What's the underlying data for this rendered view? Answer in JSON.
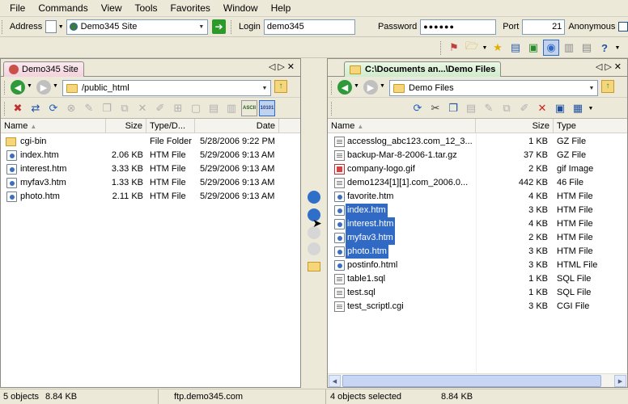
{
  "menu": [
    "File",
    "Commands",
    "View",
    "Tools",
    "Favorites",
    "Window",
    "Help"
  ],
  "address": {
    "label": "Address",
    "value": "Demo345 Site",
    "login_label": "Login",
    "login_value": "demo345",
    "password_label": "Password",
    "password_value": "●●●●●●",
    "port_label": "Port",
    "port_value": "21",
    "anonymous_label": "Anonymous"
  },
  "left": {
    "tab": "Demo345 Site",
    "path": "/public_html",
    "columns": {
      "name": "Name",
      "size": "Size",
      "type": "Type/D...",
      "date": "Date"
    },
    "files": [
      {
        "name": "cgi-bin",
        "size": "",
        "type": "File Folder",
        "date": "5/28/2006 9:22 PM",
        "icon": "folder-icon"
      },
      {
        "name": "index.htm",
        "size": "2.06 KB",
        "type": "HTM File",
        "date": "5/29/2006 9:13 AM",
        "icon": "htm-file-icon"
      },
      {
        "name": "interest.htm",
        "size": "3.33 KB",
        "type": "HTM File",
        "date": "5/29/2006 9:13 AM",
        "icon": "htm-file-icon"
      },
      {
        "name": "myfav3.htm",
        "size": "1.33 KB",
        "type": "HTM File",
        "date": "5/29/2006 9:13 AM",
        "icon": "htm-file-icon"
      },
      {
        "name": "photo.htm",
        "size": "2.11 KB",
        "type": "HTM File",
        "date": "5/29/2006 9:13 AM",
        "icon": "htm-file-icon"
      }
    ]
  },
  "right": {
    "tab": "C:\\Documents an...\\Demo Files",
    "path": "Demo Files",
    "columns": {
      "name": "Name",
      "size": "Size",
      "type": "Type"
    },
    "files": [
      {
        "name": "accesslog_abc123.com_12_3...",
        "size": "1 KB",
        "type": "GZ File",
        "icon": "doc-file-icon",
        "selected": false
      },
      {
        "name": "backup-Mar-8-2006-1.tar.gz",
        "size": "37 KB",
        "type": "GZ File",
        "icon": "doc-file-icon",
        "selected": false
      },
      {
        "name": "company-logo.gif",
        "size": "2 KB",
        "type": "gif Image",
        "icon": "gif-file-icon",
        "selected": false
      },
      {
        "name": "demo1234[1][1].com_2006.0...",
        "size": "442 KB",
        "type": "46 File",
        "icon": "doc-file-icon",
        "selected": false
      },
      {
        "name": "favorite.htm",
        "size": "4 KB",
        "type": "HTM File",
        "icon": "htm-file-icon",
        "selected": false
      },
      {
        "name": "index.htm",
        "size": "3 KB",
        "type": "HTM File",
        "icon": "htm-file-icon",
        "selected": true
      },
      {
        "name": "interest.htm",
        "size": "4 KB",
        "type": "HTM File",
        "icon": "htm-file-icon",
        "selected": true
      },
      {
        "name": "myfav3.htm",
        "size": "2 KB",
        "type": "HTM File",
        "icon": "htm-file-icon",
        "selected": true
      },
      {
        "name": "photo.htm",
        "size": "3 KB",
        "type": "HTM File",
        "icon": "htm-file-icon",
        "selected": true
      },
      {
        "name": "postinfo.html",
        "size": "3 KB",
        "type": "HTML File",
        "icon": "htm-file-icon",
        "selected": false
      },
      {
        "name": "table1.sql",
        "size": "1 KB",
        "type": "SQL File",
        "icon": "doc-file-icon",
        "selected": false
      },
      {
        "name": "test.sql",
        "size": "1 KB",
        "type": "SQL File",
        "icon": "doc-file-icon",
        "selected": false
      },
      {
        "name": "test_scriptl.cgi",
        "size": "3 KB",
        "type": "CGI File",
        "icon": "doc-file-icon",
        "selected": false
      }
    ]
  },
  "status": {
    "left_count": "5 objects",
    "left_size": "8.84 KB",
    "host": "ftp.demo345.com",
    "right_count": "4 objects selected",
    "right_size": "8.84 KB"
  },
  "colors": {
    "selection": "#316ac5",
    "chrome": "#ece9d8"
  }
}
